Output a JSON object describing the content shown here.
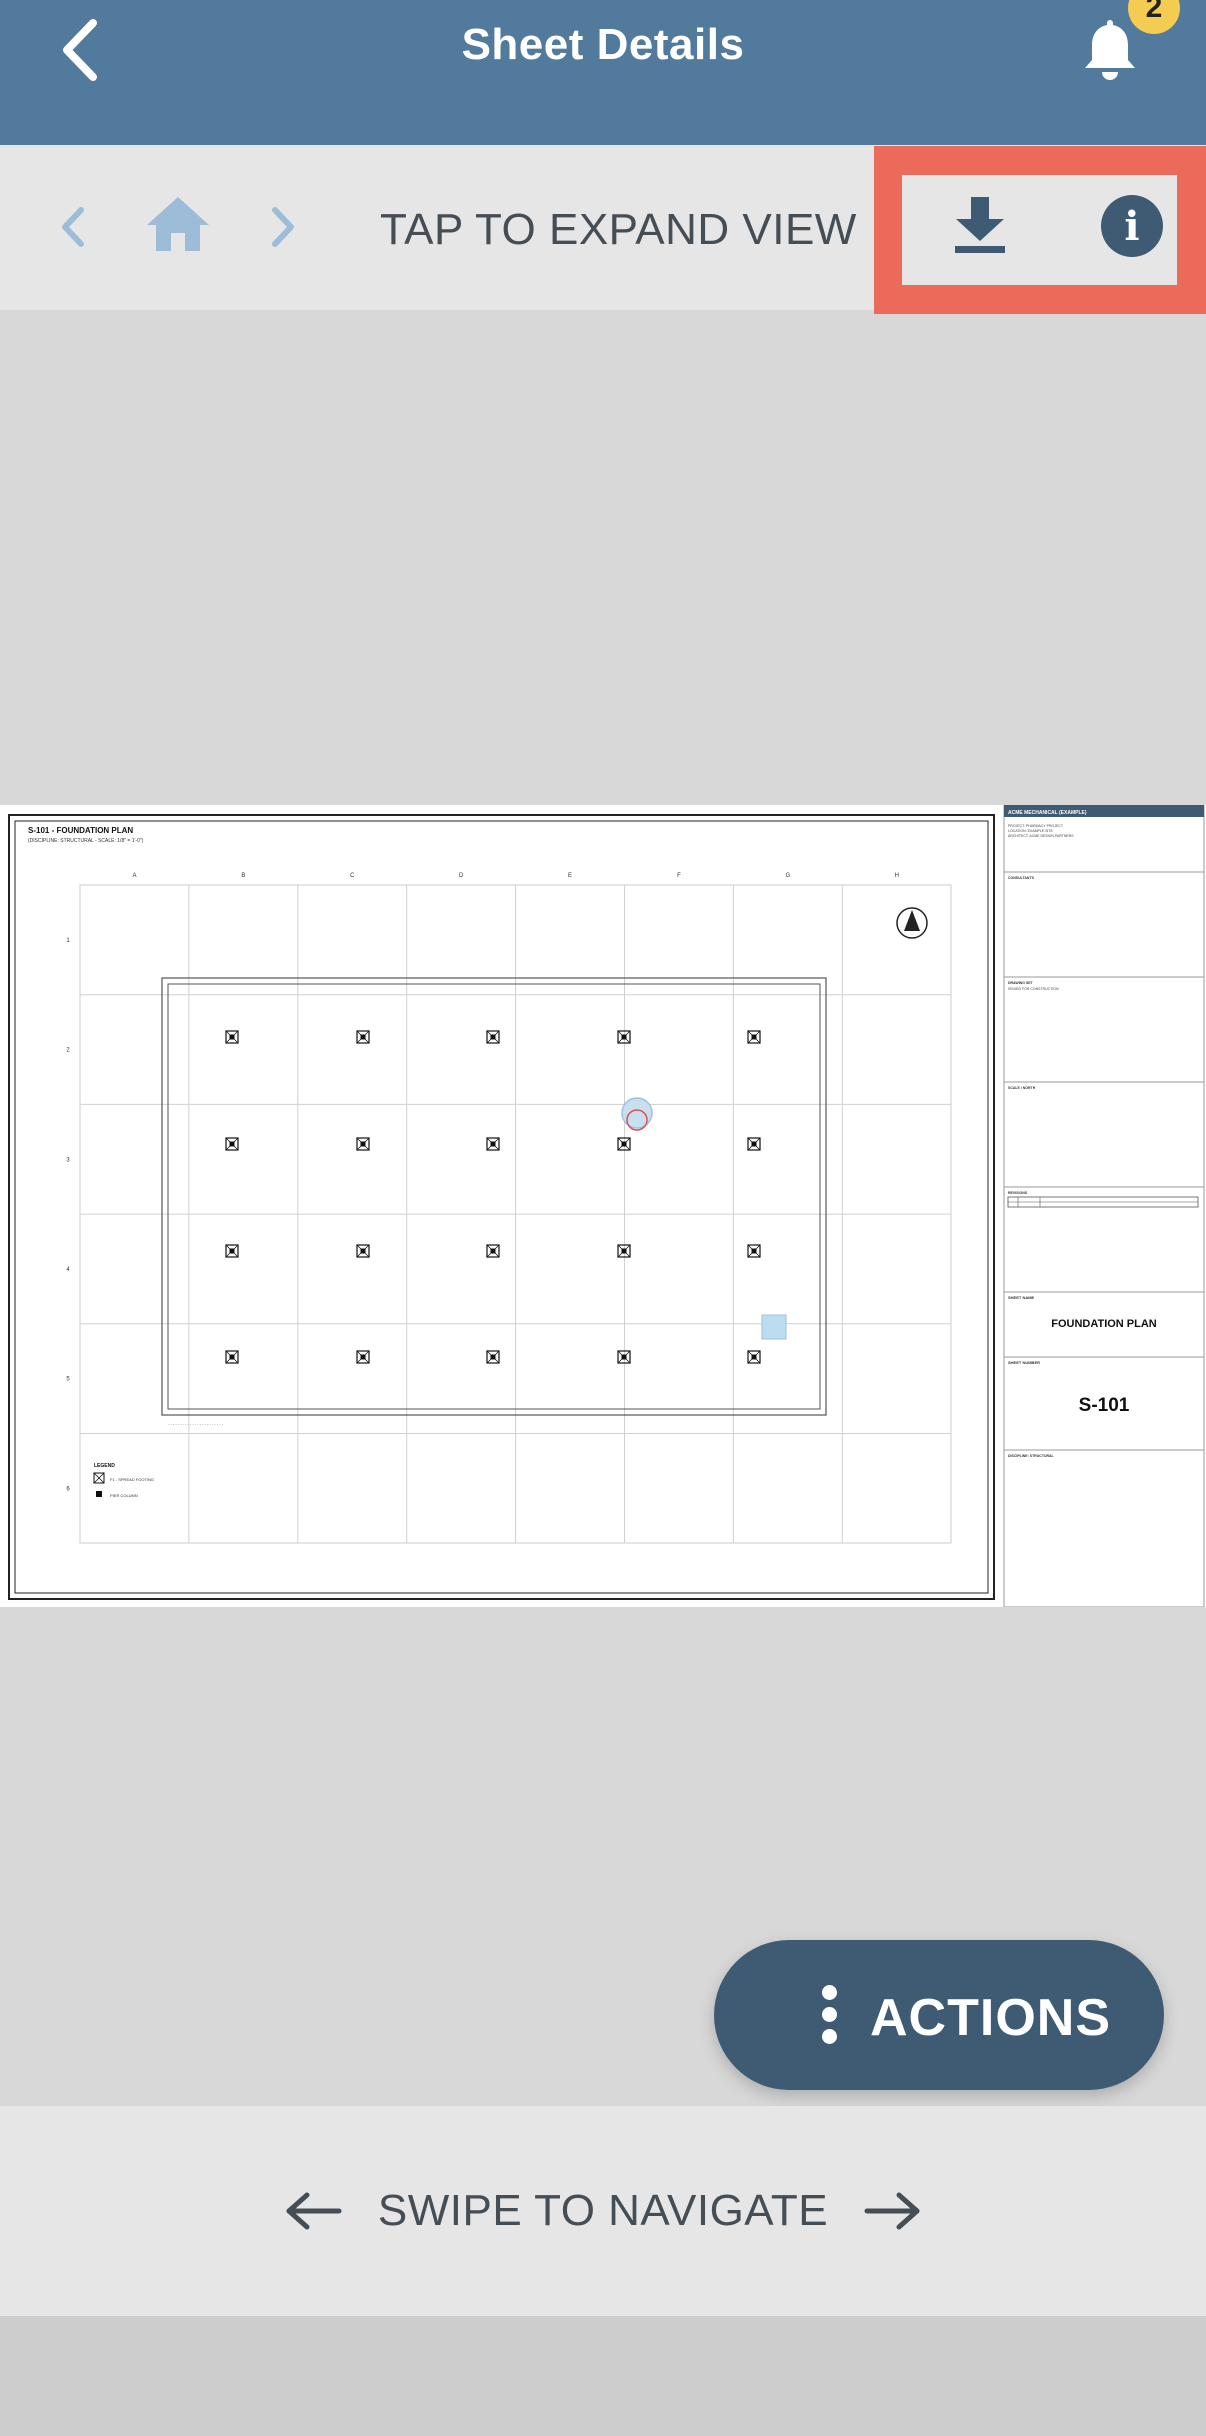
{
  "header": {
    "title": "Sheet Details",
    "notification_count": "2",
    "back_icon": "chevron-left-icon",
    "bell_icon": "bell-icon"
  },
  "toolbar": {
    "prev_icon": "chevron-left-icon",
    "home_icon": "home-icon",
    "next_icon": "chevron-right-icon",
    "expand_label": "TAP TO EXPAND VIEW",
    "download_icon": "download-icon",
    "info_icon": "info-icon",
    "info_glyph": "i"
  },
  "sheet": {
    "title": "S-101 - FOUNDATION PLAN",
    "subtitle": "(DISCIPLINE: STRUCTURAL - SCALE: 1/8\" = 1'-0\")",
    "column_labels": [
      "A",
      "B",
      "C",
      "D",
      "E",
      "F",
      "G",
      "H"
    ],
    "row_labels": [
      "1",
      "2",
      "3",
      "4",
      "5",
      "6"
    ],
    "legend_title": "LEGEND",
    "legend_items": [
      "F1 - SPREAD FOOTING",
      "PIER COLUMN"
    ],
    "title_block": {
      "company": "ACME MECHANICAL (EXAMPLE)",
      "project_lines": [
        "PROJECT: PHARMACY PROJECT",
        "LOCATION: EXAMPLE SITE",
        "ARCHITECT: ACME DESIGN PARTNERS"
      ],
      "consultants_label": "CONSULTANTS",
      "drawing_set_label": "DRAWING SET",
      "drawing_set_value": "ISSUED FOR CONSTRUCTION",
      "scale_label": "SCALE / NORTH",
      "revisions_label": "REVISIONS",
      "sheet_name_label": "SHEET NAME",
      "sheet_name": "FOUNDATION PLAN",
      "sheet_number_label": "SHEET NUMBER",
      "sheet_number": "S-101",
      "discipline_label": "DISCIPLINE: STRUCTURAL"
    }
  },
  "actions": {
    "label": "ACTIONS",
    "menu_icon": "more-vertical-icon"
  },
  "footer": {
    "swipe_label": "SWIPE TO NAVIGATE",
    "left_arrow_icon": "arrow-left-icon",
    "right_arrow_icon": "arrow-right-icon"
  },
  "colors": {
    "header_bg": "#517a9c",
    "toolbar_bg": "#e6e6e6",
    "highlight": "#ec6a5a",
    "badge": "#f5cc52",
    "actions_bg": "#3f5a73",
    "nav_icon": "#9dbcd8"
  }
}
